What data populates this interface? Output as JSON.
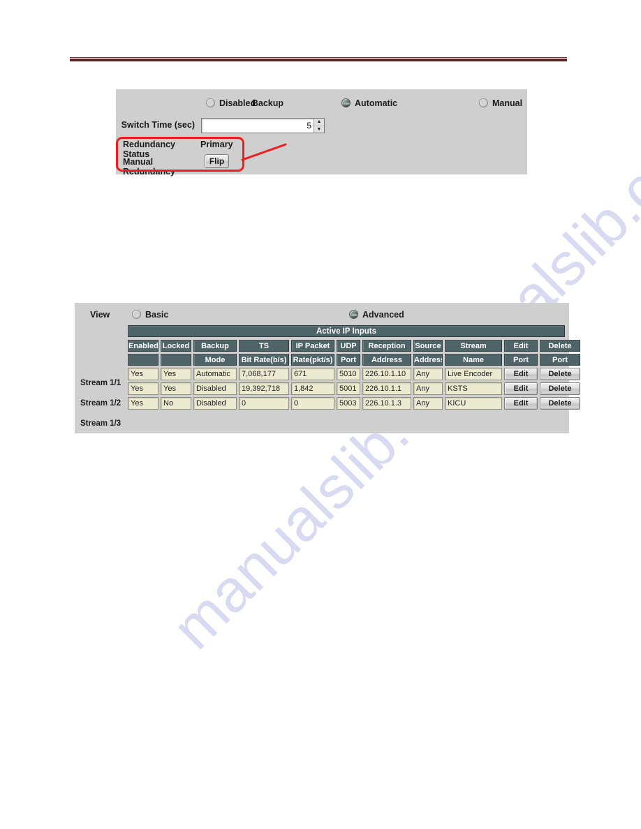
{
  "watermark": {
    "line1": "manualslib.com",
    "line2": "manualslib.com"
  },
  "redundancy_panel": {
    "backup_label": "Backup",
    "options": [
      {
        "label": "Disabled",
        "selected": false
      },
      {
        "label": "Automatic",
        "selected": true
      },
      {
        "label": "Manual",
        "selected": false
      }
    ],
    "switch_time_label": "Switch Time (sec)",
    "switch_time_value": "5",
    "redundancy_status_label": "Redundancy Status",
    "redundancy_status_value": "Primary",
    "manual_redundancy_label": "Manual Redundancy",
    "flip_button_label": "Flip"
  },
  "inputs_panel": {
    "view_label": "View",
    "view_options": [
      {
        "label": "Basic",
        "selected": false
      },
      {
        "label": "Advanced",
        "selected": true
      }
    ],
    "table_title": "Active IP Inputs",
    "headers_top": [
      "Enabled",
      "Locked",
      "Backup",
      "TS",
      "IP Packet",
      "UDP",
      "Reception",
      "Source",
      "Stream",
      "Edit",
      "Delete"
    ],
    "headers_bottom": [
      "",
      "",
      "Mode",
      "Bit Rate(b/s)",
      "Rate(pkt/s)",
      "Port",
      "Address",
      "Address",
      "Name",
      "Port",
      "Port"
    ],
    "rows": [
      {
        "stream": "Stream 1/1",
        "enabled": "Yes",
        "locked": "Yes",
        "backup_mode": "Automatic",
        "ts_bit_rate": "7,068,177",
        "ip_packet_rate": "671",
        "udp_port": "5010",
        "reception_address": "226.10.1.10",
        "source_address": "Any",
        "stream_name": "Live Encoder",
        "edit": "Edit",
        "delete": "Delete"
      },
      {
        "stream": "Stream 1/2",
        "enabled": "Yes",
        "locked": "Yes",
        "backup_mode": "Disabled",
        "ts_bit_rate": "19,392,718",
        "ip_packet_rate": "1,842",
        "udp_port": "5001",
        "reception_address": "226.10.1.1",
        "source_address": "Any",
        "stream_name": "KSTS",
        "edit": "Edit",
        "delete": "Delete"
      },
      {
        "stream": "Stream 1/3",
        "enabled": "Yes",
        "locked": "No",
        "backup_mode": "Disabled",
        "ts_bit_rate": "0",
        "ip_packet_rate": "0",
        "udp_port": "5003",
        "reception_address": "226.10.1.3",
        "source_address": "Any",
        "stream_name": "KICU",
        "edit": "Edit",
        "delete": "Delete"
      }
    ]
  },
  "colors": {
    "panel_bg": "#cfcfcf",
    "header_teal": "#4e6468",
    "field_cream": "#ecead0",
    "rule_maroon": "#5e2222",
    "annotation_red": "#ee1d1d"
  }
}
